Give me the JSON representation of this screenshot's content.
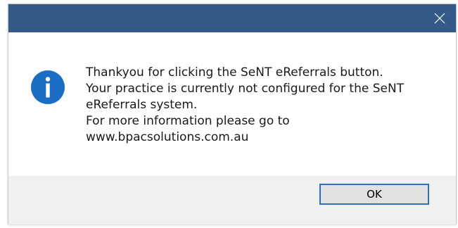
{
  "dialog": {
    "title": "",
    "close_icon": "close-icon",
    "icon": "info-icon",
    "message_lines": [
      "Thankyou for clicking the SeNT eReferrals button.",
      "Your practice is currently not configured for the SeNT",
      "eReferrals system.",
      "For more information please go to",
      "www.bpacsolutions.com.au"
    ],
    "ok_label": "OK"
  },
  "colors": {
    "titlebar": "#345a8a",
    "icon_blue": "#1a6fc4",
    "footer": "#f0f0f0",
    "button_border": "#2f6fc0"
  }
}
